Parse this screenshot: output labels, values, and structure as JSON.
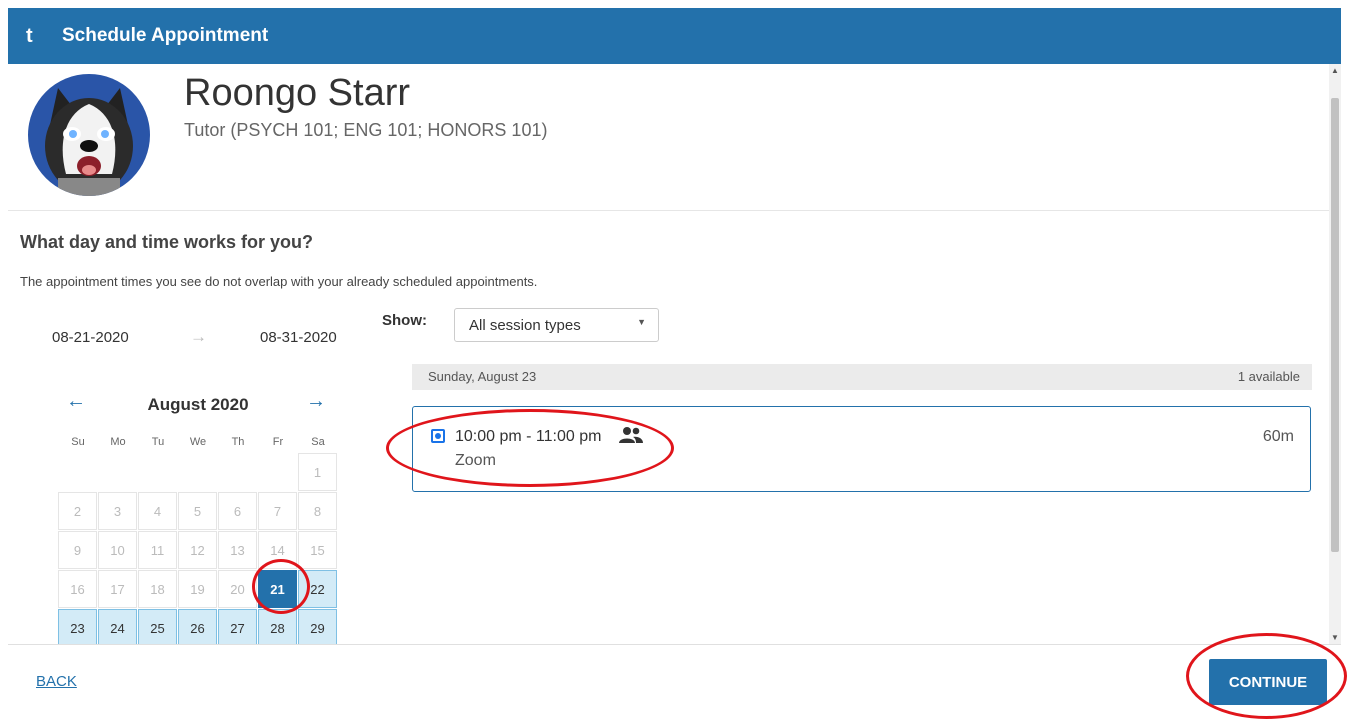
{
  "header": {
    "logo": "t",
    "title": "Schedule Appointment"
  },
  "tutor": {
    "name": "Roongo Starr",
    "role": "Tutor (PSYCH 101; ENG 101; HONORS 101)"
  },
  "prompt": {
    "question": "What day and time works for you?",
    "note": "The appointment times you see do not overlap with your already scheduled appointments."
  },
  "range": {
    "start": "08-21-2020",
    "end": "08-31-2020"
  },
  "calendar": {
    "month": "August 2020",
    "weekdays": [
      "Su",
      "Mo",
      "Tu",
      "We",
      "Th",
      "Fr",
      "Sa"
    ],
    "weeks": [
      [
        null,
        null,
        null,
        null,
        null,
        null,
        {
          "n": "1",
          "s": "off"
        }
      ],
      [
        {
          "n": "2",
          "s": "off"
        },
        {
          "n": "3",
          "s": "off"
        },
        {
          "n": "4",
          "s": "off"
        },
        {
          "n": "5",
          "s": "off"
        },
        {
          "n": "6",
          "s": "off"
        },
        {
          "n": "7",
          "s": "off"
        },
        {
          "n": "8",
          "s": "off"
        }
      ],
      [
        {
          "n": "9",
          "s": "off"
        },
        {
          "n": "10",
          "s": "off"
        },
        {
          "n": "11",
          "s": "off"
        },
        {
          "n": "12",
          "s": "off"
        },
        {
          "n": "13",
          "s": "off"
        },
        {
          "n": "14",
          "s": "off"
        },
        {
          "n": "15",
          "s": "off"
        }
      ],
      [
        {
          "n": "16",
          "s": "off"
        },
        {
          "n": "17",
          "s": "off"
        },
        {
          "n": "18",
          "s": "off"
        },
        {
          "n": "19",
          "s": "off"
        },
        {
          "n": "20",
          "s": "off"
        },
        {
          "n": "21",
          "s": "selected"
        },
        {
          "n": "22",
          "s": "avail"
        }
      ],
      [
        {
          "n": "23",
          "s": "avail"
        },
        {
          "n": "24",
          "s": "avail"
        },
        {
          "n": "25",
          "s": "avail"
        },
        {
          "n": "26",
          "s": "avail"
        },
        {
          "n": "27",
          "s": "avail"
        },
        {
          "n": "28",
          "s": "avail"
        },
        {
          "n": "29",
          "s": "avail"
        }
      ]
    ]
  },
  "filter": {
    "label": "Show:",
    "value": "All session types"
  },
  "day": {
    "label": "Sunday, August 23",
    "available": "1 available"
  },
  "slot": {
    "time": "10:00 pm - 11:00 pm",
    "location": "Zoom",
    "duration": "60m",
    "selected": true
  },
  "footer": {
    "back": "BACK",
    "continue": "CONTINUE"
  },
  "colors": {
    "brand": "#2371ab",
    "annotation": "#e0151b",
    "available_day": "#d3ebf7"
  },
  "icons": {
    "group": "group-icon",
    "prev": "arrow-left-icon",
    "next": "arrow-right-icon"
  }
}
